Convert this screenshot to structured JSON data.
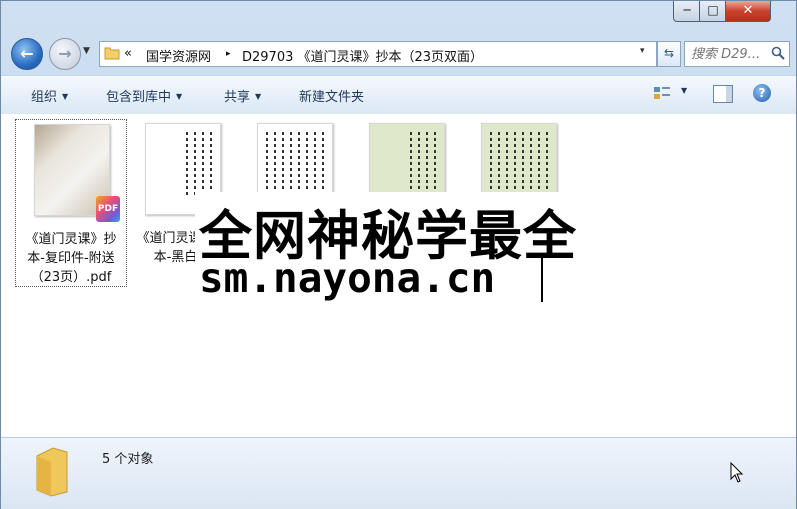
{
  "window": {
    "minimize": "─",
    "maximize": "□",
    "close": "✕"
  },
  "nav": {
    "back_glyph": "←",
    "forward_glyph": "→",
    "recent_glyph": "▼"
  },
  "address": {
    "chevron": "«",
    "crumbs": [
      "国学资源网",
      "D29703 《道门灵课》抄本（23页双面）"
    ],
    "separator": "▸",
    "dropdown_glyph": "▾"
  },
  "refresh_glyph": "⇆",
  "search": {
    "placeholder": "搜索 D29..."
  },
  "toolbar": {
    "organize": "组织",
    "include_library": "包含到库中",
    "share": "共享",
    "new_folder": "新建文件夹",
    "dropdown_glyph": "▼",
    "help_glyph": "?"
  },
  "files": [
    {
      "name": "《道门灵课》抄本-复印件-附送（23页）.pdf",
      "badge": "PDF"
    },
    {
      "name": "《道门灵课》抄本-黑白单"
    },
    {
      "name": ""
    },
    {
      "name": ""
    },
    {
      "name": ""
    }
  ],
  "watermark": {
    "line1": "全网神秘学最全",
    "line2": "sm.nayona.cn"
  },
  "status": {
    "count_text": "5 个对象"
  },
  "colors": {
    "chrome": "#b9d1ea",
    "toolbar_text": "#1e395b",
    "close_button": "#c8432c"
  }
}
